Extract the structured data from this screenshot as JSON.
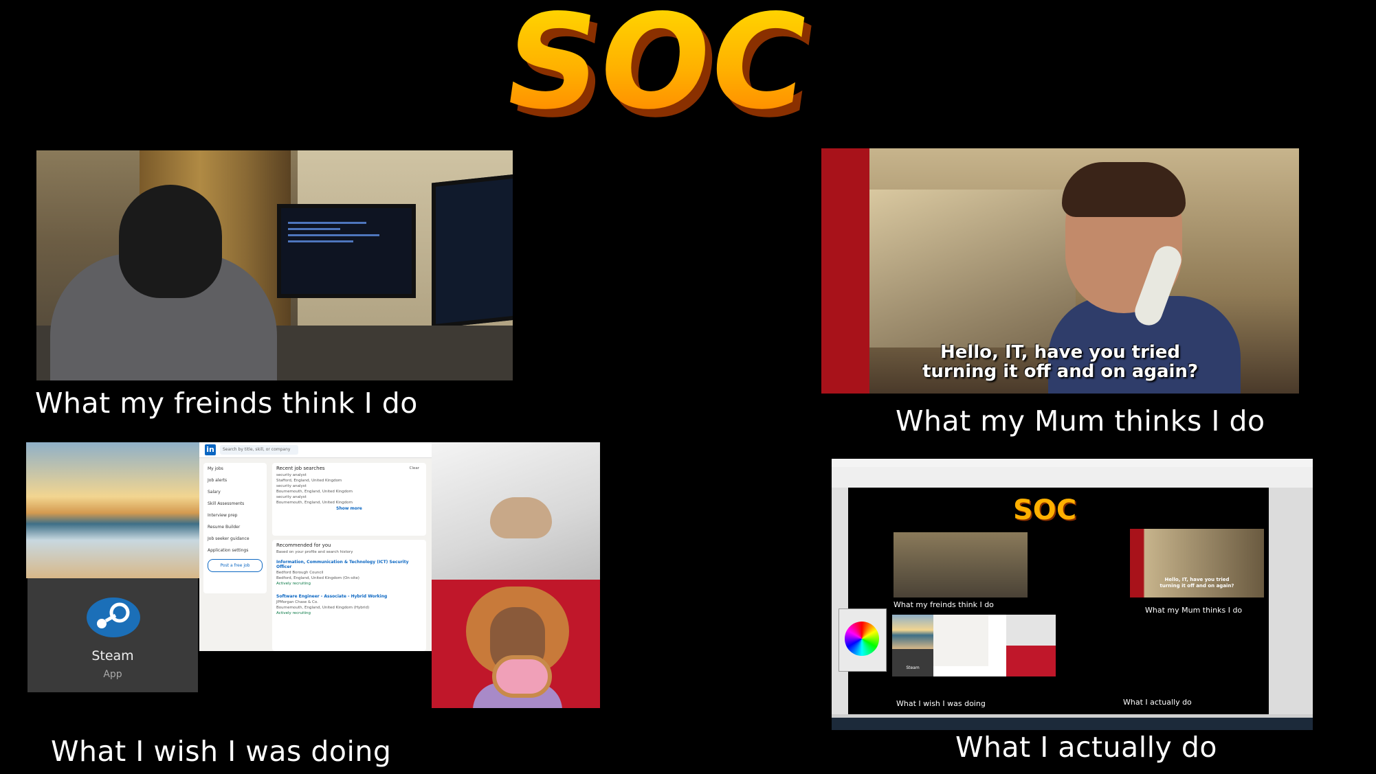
{
  "title": {
    "text": "SOC"
  },
  "panels": [
    {
      "caption": "What my freinds think I do"
    },
    {
      "caption": "What my Mum thinks I do",
      "subtitle_line1": "Hello, IT, have you tried",
      "subtitle_line2": "turning it off and on again?"
    },
    {
      "caption": "What I wish I was doing",
      "steam_label": "Steam",
      "steam_sub": "App"
    },
    {
      "caption": "What I actually do"
    }
  ],
  "linkedin": {
    "logo": "in",
    "search_placeholder": "Search by title, skill, or company",
    "sidebar": [
      "My jobs",
      "Job alerts",
      "Salary",
      "Skill Assessments",
      "Interview prep",
      "Resume Builder",
      "Job seeker guidance",
      "Application settings"
    ],
    "post_job": "Post a free job",
    "recent_heading": "Recent job searches",
    "clear": "Clear",
    "recent_items": [
      {
        "title": "security analyst",
        "loc": "Stafford, England, United Kingdom"
      },
      {
        "title": "security analyst",
        "loc": "Bournemouth, England, United Kingdom"
      },
      {
        "title": "security analyst",
        "loc": "Bournemouth, England, United Kingdom"
      }
    ],
    "show_more": "Show more",
    "recommended_heading": "Recommended for you",
    "recommended_sub": "Based on your profile and search history",
    "jobs": [
      {
        "title": "Information, Communication & Technology (ICT) Security Officer",
        "company": "Bedford Borough Council",
        "loc": "Bedford, England, United Kingdom (On-site)",
        "status": "Actively recruiting"
      },
      {
        "title": "Software Engineer - Associate - Hybrid Working",
        "company": "JPMorgan Chase & Co.",
        "loc": "Bournemouth, England, United Kingdom (Hybrid)",
        "status": "Actively recruiting"
      }
    ]
  },
  "mini": {
    "title": "SOC",
    "captions": [
      "What my freinds think I do",
      "What my Mum thinks I do",
      "What I wish I was doing",
      "What I actually do"
    ],
    "subtitle_line1": "Hello, IT, have you tried",
    "subtitle_line2": "turning it off and on again?",
    "steam_label": "Steam"
  },
  "colors": {
    "background": "#000000",
    "soc_gold": "#ffb000",
    "soc_shadow": "#8a3000",
    "linkedin_blue": "#0a66c2",
    "steam_blue": "#1b6fb8"
  },
  "icons": [
    "steam-icon",
    "linkedin-icon",
    "search-icon",
    "color-wheel-icon"
  ]
}
